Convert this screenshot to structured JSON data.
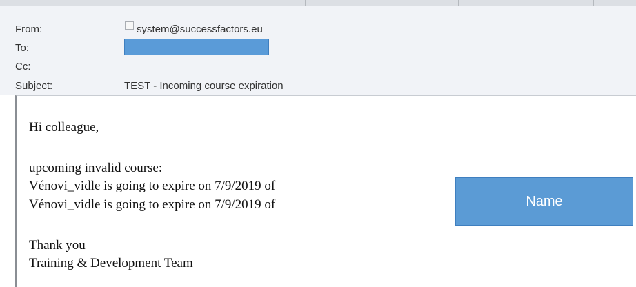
{
  "email": {
    "from_label": "From:",
    "from_value": "system@successfactors.eu",
    "to_label": "To:",
    "cc_label": "Cc:",
    "subject_label": "Subject:",
    "subject_value": "TEST - Incoming course expiration"
  },
  "body": {
    "greeting": "Hi colleague,",
    "intro": "upcoming invalid course:",
    "lines": [
      "Vénovi_vidle is going to expire on 7/9/2019 of",
      "Vénovi_vidle is going to expire on 7/9/2019 of"
    ],
    "closing": "Thank you",
    "signature": "Training & Development Team"
  },
  "annotation": {
    "name_label": "Name"
  }
}
